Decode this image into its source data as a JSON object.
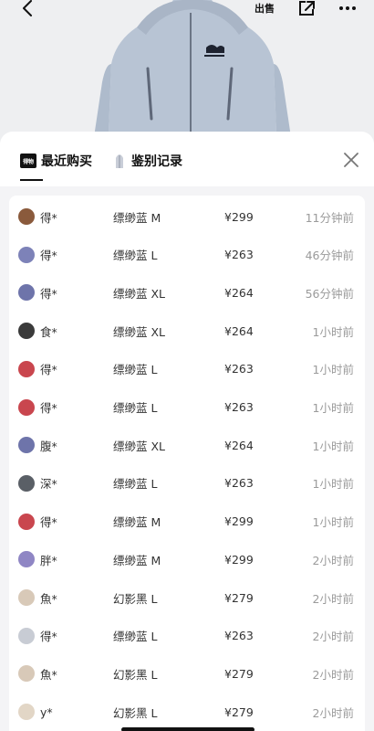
{
  "nav": {
    "sell_label": "出售"
  },
  "tabs": [
    {
      "label": "最近购买",
      "logo_text": "得物"
    },
    {
      "label": "鉴别记录"
    }
  ],
  "purchases": [
    {
      "buyer": "得*",
      "variant": "缥缈蓝 M",
      "price": "¥299",
      "time": "11分钟前",
      "avatar_color": "#8a5a3c"
    },
    {
      "buyer": "得*",
      "variant": "缥缈蓝 L",
      "price": "¥263",
      "time": "46分钟前",
      "avatar_color": "#7d82b8"
    },
    {
      "buyer": "得*",
      "variant": "缥缈蓝 XL",
      "price": "¥264",
      "time": "56分钟前",
      "avatar_color": "#6e74aa"
    },
    {
      "buyer": "食*",
      "variant": "缥缈蓝 XL",
      "price": "¥264",
      "time": "1小时前",
      "avatar_color": "#3a3a3a"
    },
    {
      "buyer": "得*",
      "variant": "缥缈蓝 L",
      "price": "¥263",
      "time": "1小时前",
      "avatar_color": "#c9464e"
    },
    {
      "buyer": "得*",
      "variant": "缥缈蓝 L",
      "price": "¥263",
      "time": "1小时前",
      "avatar_color": "#c9464e"
    },
    {
      "buyer": "腹*",
      "variant": "缥缈蓝 XL",
      "price": "¥264",
      "time": "1小时前",
      "avatar_color": "#6e74aa"
    },
    {
      "buyer": "深*",
      "variant": "缥缈蓝 L",
      "price": "¥263",
      "time": "1小时前",
      "avatar_color": "#5a5f66"
    },
    {
      "buyer": "得*",
      "variant": "缥缈蓝 M",
      "price": "¥299",
      "time": "1小时前",
      "avatar_color": "#c9464e"
    },
    {
      "buyer": "胖*",
      "variant": "缥缈蓝 M",
      "price": "¥299",
      "time": "2小时前",
      "avatar_color": "#8f86c4"
    },
    {
      "buyer": "魚*",
      "variant": "幻影黑 L",
      "price": "¥279",
      "time": "2小时前",
      "avatar_color": "#d8c9b8"
    },
    {
      "buyer": "得*",
      "variant": "缥缈蓝 L",
      "price": "¥263",
      "time": "2小时前",
      "avatar_color": "#c8ccd4"
    },
    {
      "buyer": "魚*",
      "variant": "幻影黑 L",
      "price": "¥279",
      "time": "2小时前",
      "avatar_color": "#d8c9b8"
    },
    {
      "buyer": "y*",
      "variant": "幻影黑 L",
      "price": "¥279",
      "time": "2小时前",
      "avatar_color": "#e2d6c6"
    }
  ]
}
